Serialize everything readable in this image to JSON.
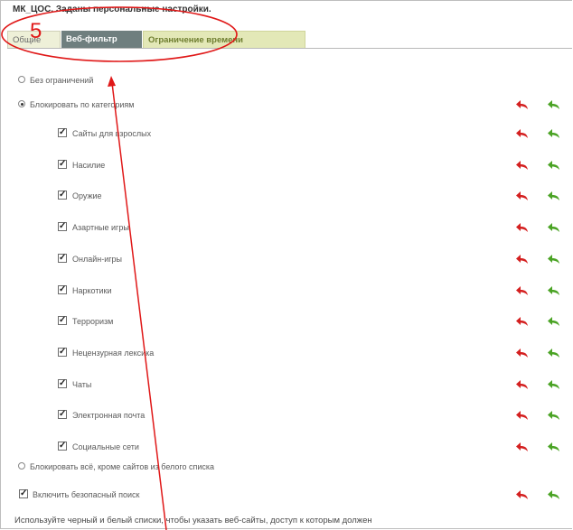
{
  "window": {
    "title": "МК_ЦОС. Заданы персональные настройки."
  },
  "tabs": [
    {
      "label": "Общие"
    },
    {
      "label": "Веб-фильтр"
    },
    {
      "label": "Ограничение времени"
    }
  ],
  "options": {
    "no_restrictions": "Без ограничений",
    "block_categories": "Блокировать по категориям",
    "block_all_except_white": "Блокировать всё, кроме сайтов из белого списка",
    "safe_search": "Включить безопасный поиск"
  },
  "categories": [
    {
      "label": "Сайты для взрослых",
      "checked": true
    },
    {
      "label": "Насилие",
      "checked": true
    },
    {
      "label": "Оружие",
      "checked": true
    },
    {
      "label": "Азартные игры",
      "checked": true
    },
    {
      "label": "Онлайн-игры",
      "checked": true
    },
    {
      "label": "Наркотики",
      "checked": true
    },
    {
      "label": "Терроризм",
      "checked": true
    },
    {
      "label": "Нецензурная лексика",
      "checked": true
    },
    {
      "label": "Чаты",
      "checked": true
    },
    {
      "label": "Электронная почта",
      "checked": true
    },
    {
      "label": "Социальные сети",
      "checked": true
    }
  ],
  "selected_option": "block_categories",
  "safe_search_checked": true,
  "footer": {
    "text": "Используйте черный и белый списки, чтобы указать веб-сайты, доступ к которым должен"
  },
  "annotation": {
    "number": "5"
  },
  "colors": {
    "red_arrow": "#d42020",
    "green_arrow": "#4aa324",
    "callout": "#e01818"
  },
  "icons": {
    "reset": "undo-arrow-icon"
  }
}
